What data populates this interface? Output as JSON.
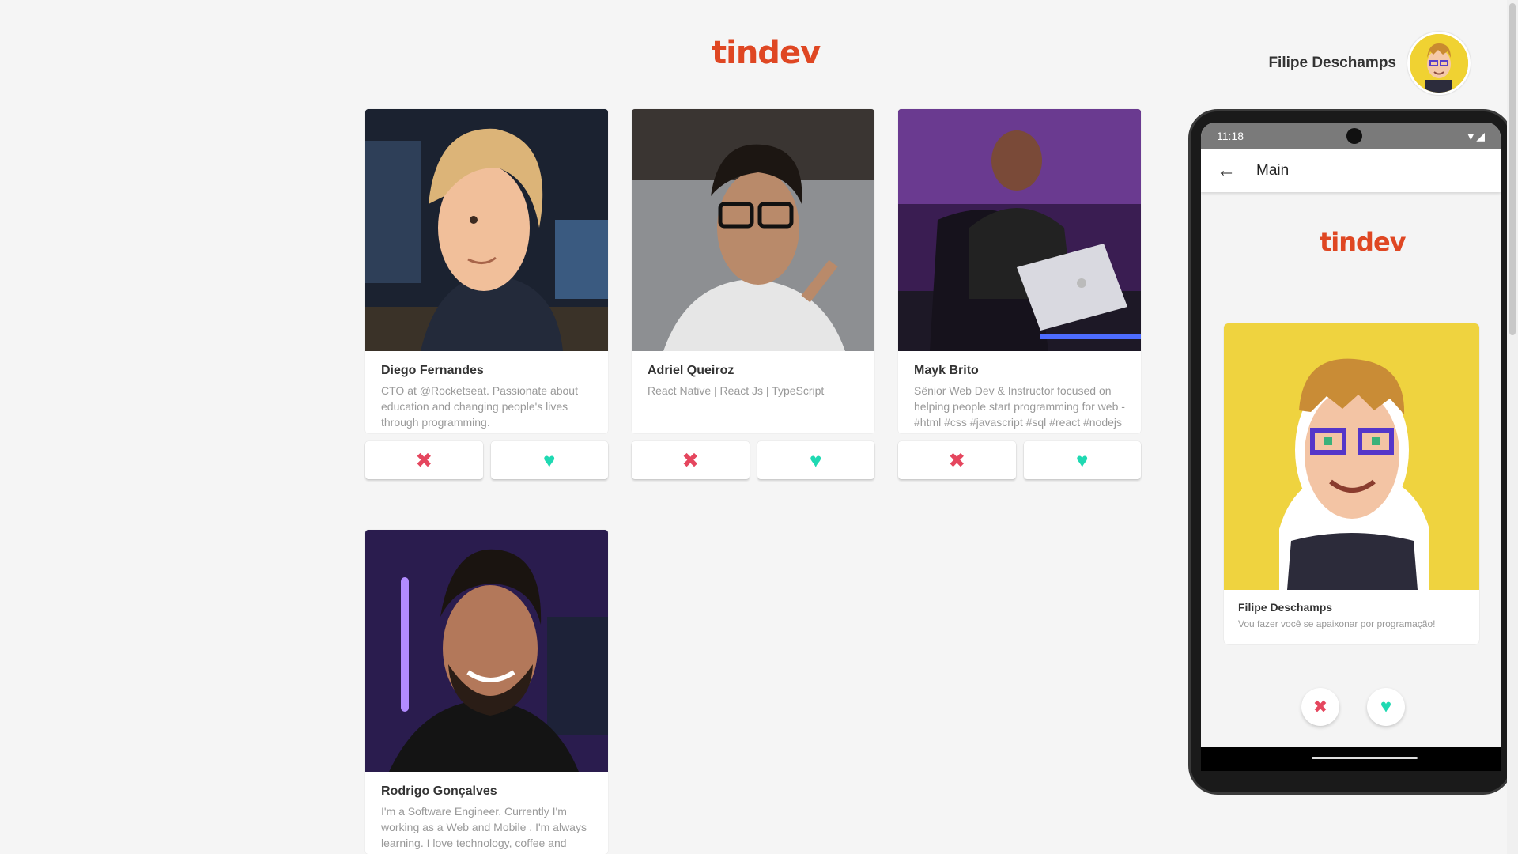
{
  "header": {
    "logo": "tindev",
    "user_name": "Filipe Deschamps"
  },
  "cards": [
    {
      "name": "Diego Fernandes",
      "bio": "CTO at @Rocketseat. Passionate about education and changing people's lives through programming."
    },
    {
      "name": "Adriel Queiroz",
      "bio": "React Native | React Js | TypeScript"
    },
    {
      "name": "Mayk Brito",
      "bio": "Sênior Web Dev & Instructor focused on helping people start programming for web - #html #css #javascript #sql #react #nodejs #fullstack"
    },
    {
      "name": "Rodrigo Gonçalves",
      "bio": "I'm a Software Engineer. Currently I'm working as a Web and Mobile . I'm always learning. I love technology, coffee and"
    }
  ],
  "actions": {
    "dislike_icon": "x-icon",
    "like_icon": "heart-icon"
  },
  "phone": {
    "time": "11:18",
    "appbar_title": "Main",
    "logo": "tindev",
    "card": {
      "name": "Filipe Deschamps",
      "bio": "Vou fazer você se apaixonar por programação!"
    }
  },
  "colors": {
    "brand": "#df4723",
    "dislike": "#e5465e",
    "like": "#1fd9b2"
  }
}
